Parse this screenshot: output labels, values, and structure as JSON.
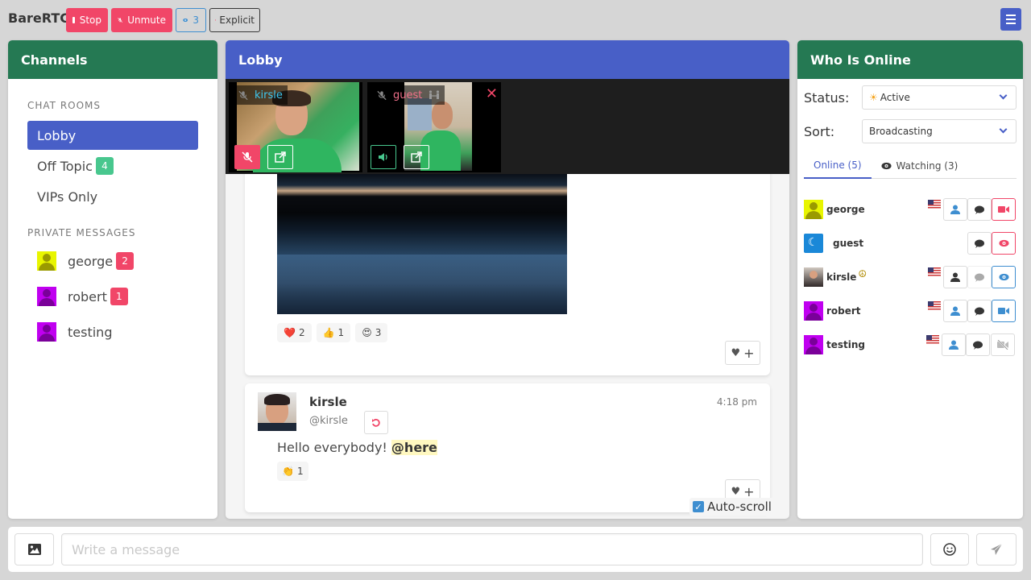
{
  "topbar": {
    "brand": "BareRTC",
    "stop_label": "Stop",
    "unmute_label": "Unmute",
    "watchers_count": "3",
    "explicit_label": "Explicit"
  },
  "colors": {
    "green_header": "#257953",
    "blue_header": "#485fc7",
    "danger": "#f14668",
    "info": "#3e8ed0",
    "success": "#48c78e"
  },
  "channels": {
    "title": "Channels",
    "chat_rooms_label": "CHAT ROOMS",
    "rooms": [
      {
        "name": "Lobby",
        "active": true,
        "badge": null
      },
      {
        "name": "Off Topic",
        "active": false,
        "badge": "4"
      },
      {
        "name": "VIPs Only",
        "active": false,
        "badge": null
      }
    ],
    "private_messages_label": "PRIVATE MESSAGES",
    "private_messages": [
      {
        "name": "george",
        "badge": "2",
        "avatar_color": "#e8f500"
      },
      {
        "name": "robert",
        "badge": "1",
        "avatar_color": "#c000f0"
      },
      {
        "name": "testing",
        "badge": null,
        "avatar_color": "#c000f0"
      }
    ]
  },
  "lobby": {
    "title": "Lobby",
    "video_feeds": [
      {
        "username": "kirsle",
        "name_color": "#3e8ed0",
        "muted": true
      },
      {
        "username": "guest",
        "name_color": "#f14668",
        "muted": false
      }
    ],
    "messages": [
      {
        "type": "image",
        "reactions": [
          {
            "emoji": "❤️",
            "count": "2"
          },
          {
            "emoji": "👍",
            "count": "1"
          },
          {
            "emoji": "😍",
            "count": "3"
          }
        ]
      },
      {
        "username": "kirsle",
        "handle": "@kirsle",
        "time": "4:18 pm",
        "text": "Hello everybody!",
        "mention": "@here",
        "reactions": [
          {
            "emoji": "👏",
            "count": "1"
          }
        ]
      }
    ],
    "autoscroll_label": "Auto-scroll",
    "autoscroll_checked": true
  },
  "online": {
    "title": "Who Is Online",
    "status_label": "Status:",
    "status_value": "Active",
    "sort_label": "Sort:",
    "sort_value": "Broadcasting",
    "tab_online": "Online (5)",
    "tab_watching": "Watching (3)",
    "users": [
      {
        "name": "george",
        "flag": true,
        "profile": true,
        "dm": true,
        "video": "live-red"
      },
      {
        "name": "guest",
        "flag": false,
        "profile": false,
        "dm": true,
        "video": "watching-red"
      },
      {
        "name": "kirsle",
        "flag": true,
        "profile": true,
        "dm": "disabled",
        "video": "watching-blue",
        "emoji": "☮"
      },
      {
        "name": "robert",
        "flag": true,
        "profile": true,
        "dm": true,
        "video": "live-blue"
      },
      {
        "name": "testing",
        "flag": true,
        "profile": true,
        "dm": true,
        "video": "off"
      }
    ]
  },
  "composer": {
    "placeholder": "Write a message"
  }
}
